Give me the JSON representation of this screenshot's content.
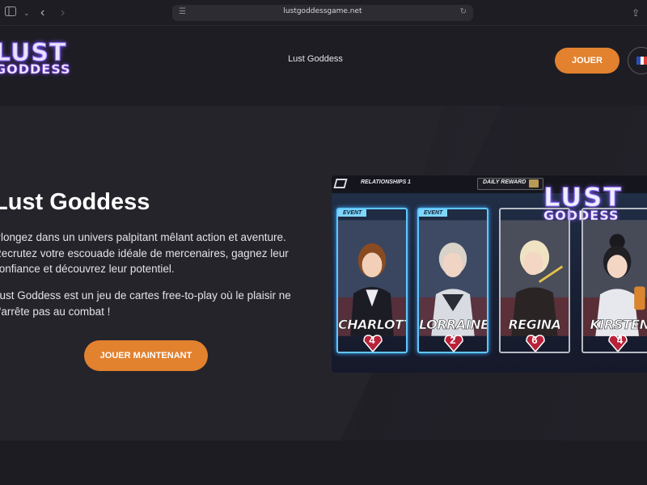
{
  "browser": {
    "url": "lustgoddessgame.net",
    "icons": {
      "sidebar": "sidebar-icon",
      "back": "chevron-left-icon",
      "forward": "chevron-right-icon",
      "reader": "reader-icon",
      "reload": "reload-icon",
      "share": "share-icon"
    }
  },
  "header": {
    "logo_line1": "LUST",
    "logo_line2": "GODDESS",
    "nav_label": "Lust Goddess",
    "play_label": "JOUER",
    "language_icon": "france-flag-icon"
  },
  "hero": {
    "title": "Lust Goddess",
    "paragraph1": "Plongez dans un univers palpitant mêlant action et aventure. Recrutez votre escouade idéale de mercenaires, gagnez leur confiance et découvrez leur potentiel.",
    "paragraph2": "Lust Goddess est un jeu de cartes free-to-play où le plaisir ne s'arrête pas au combat !",
    "cta_label": "JOUER MAINTENANT"
  },
  "promo": {
    "relationships_label": "RELATIONSHIPS",
    "relationships_count": "1",
    "daily_reward_label": "DAILY REWARD",
    "logo_line1": "LUST",
    "logo_line2": "GODDESS",
    "cards": [
      {
        "name": "CHARLOTTE",
        "level": "4",
        "tag": "EVENT"
      },
      {
        "name": "LORRAINE",
        "level": "2",
        "tag": "EVENT"
      },
      {
        "name": "REGINA",
        "level": "6",
        "tag": ""
      },
      {
        "name": "KIRSTEN",
        "level": "4",
        "tag": ""
      }
    ]
  },
  "colors": {
    "accent": "#e2812e",
    "background": "#1d1c22",
    "hero_background": "#25242b",
    "event_border": "#5fc7ff"
  }
}
